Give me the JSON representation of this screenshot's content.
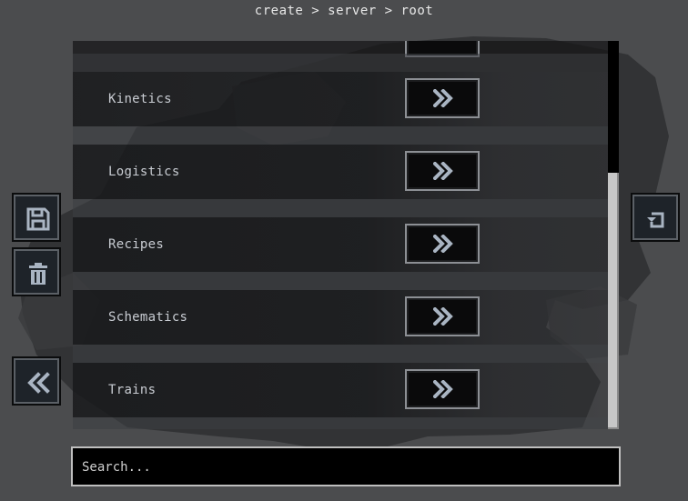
{
  "breadcrumb": {
    "text": "create > server > root"
  },
  "config_list": {
    "items": [
      {
        "label": "Kinetics",
        "icon": "double-chevron-right-icon"
      },
      {
        "label": "Logistics",
        "icon": "double-chevron-right-icon"
      },
      {
        "label": "Recipes",
        "icon": "double-chevron-right-icon"
      },
      {
        "label": "Schematics",
        "icon": "double-chevron-right-icon"
      },
      {
        "label": "Trains",
        "icon": "double-chevron-right-icon"
      }
    ]
  },
  "sidebar_left": {
    "buttons": [
      {
        "name": "save-button",
        "icon": "floppy-disk-icon"
      },
      {
        "name": "delete-button",
        "icon": "trash-icon"
      },
      {
        "name": "back-button",
        "icon": "double-chevron-left-icon"
      }
    ]
  },
  "sidebar_right": {
    "buttons": [
      {
        "name": "reset-button",
        "icon": "reset-arrow-icon"
      }
    ]
  },
  "search": {
    "placeholder": "Search...",
    "value": ""
  },
  "colors": {
    "background": "#4b4c4e",
    "button_fill": "#1e2329",
    "button_border": "#5b6066",
    "accent_icon": "#a9b4c2",
    "scrollbar_thumb": "#c7c7c7"
  }
}
